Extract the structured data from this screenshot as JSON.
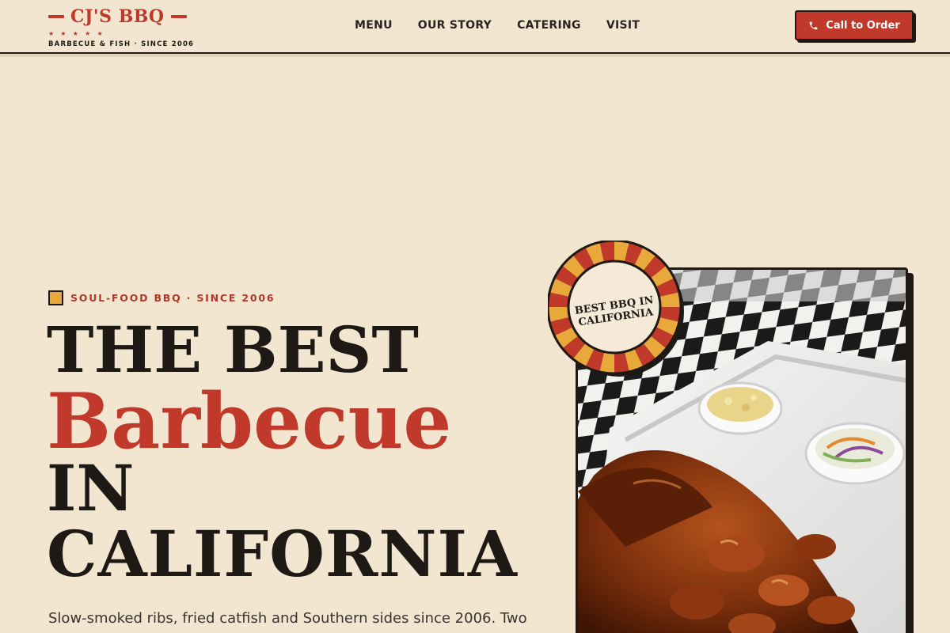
{
  "brand": {
    "name": "CJ'S BBQ",
    "stars": "★ ★ ★ ★ ★",
    "tagline": "BARBECUE & FISH · SINCE 2006"
  },
  "nav": [
    {
      "label": "MENU"
    },
    {
      "label": "OUR STORY"
    },
    {
      "label": "CATERING"
    },
    {
      "label": "VISIT"
    }
  ],
  "cta": {
    "label": "Call to Order",
    "icon": "phone-icon"
  },
  "hero": {
    "eyebrow": "SOUL-FOOD BBQ · SINCE 2006",
    "headline_line1": "THE BEST",
    "headline_line2": "Barbecue",
    "headline_line3": "IN",
    "headline_line4": "CALIFORNIA",
    "lede": "Slow-smoked ribs, fried catfish and Southern sides since 2006. Two"
  },
  "badge": {
    "line1": "BEST BBQ IN",
    "line2": "CALIFORNIA"
  },
  "colors": {
    "background": "#f3e6d1",
    "brand_red": "#c0392b",
    "ink": "#1f1915",
    "mustard": "#e8a93a"
  }
}
